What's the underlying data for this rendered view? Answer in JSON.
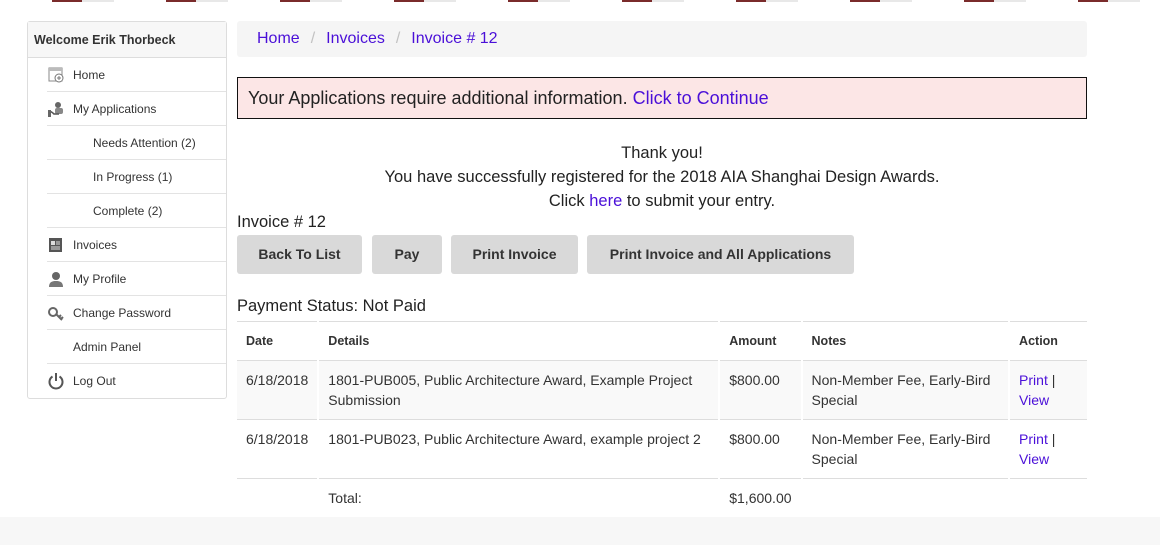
{
  "sidebar": {
    "welcome": "Welcome Erik Thorbeck",
    "items": [
      {
        "label": "Home",
        "icon": "home-icon"
      },
      {
        "label": "My Applications",
        "icon": "applications-icon"
      },
      {
        "label": "Needs Attention (2)"
      },
      {
        "label": "In Progress (1)"
      },
      {
        "label": "Complete (2)"
      },
      {
        "label": "Invoices",
        "icon": "invoice-icon"
      },
      {
        "label": "My Profile",
        "icon": "profile-icon"
      },
      {
        "label": "Change Password",
        "icon": "key-icon"
      },
      {
        "label": "Admin Panel"
      },
      {
        "label": "Log Out",
        "icon": "power-icon"
      }
    ]
  },
  "breadcrumb": [
    "Home",
    "Invoices",
    "Invoice # 12"
  ],
  "alert": {
    "text": "Your Applications require additional information.",
    "link": "Click to Continue"
  },
  "thanks": {
    "line1": "Thank you!",
    "line2": "You have successfully registered for the 2018 AIA Shanghai Design Awards.",
    "line3_pre": "Click",
    "line3_link": "here",
    "line3_post": "to submit your entry."
  },
  "invoice_title": "Invoice # 12",
  "buttons": {
    "back": "Back To List",
    "pay": "Pay",
    "print": "Print Invoice",
    "print_all": "Print Invoice and All Applications"
  },
  "payment_status": "Payment Status: Not Paid",
  "table": {
    "headers": [
      "Date",
      "Details",
      "Amount",
      "Notes",
      "Action"
    ],
    "rows": [
      {
        "date": "6/18/2018",
        "details": "1801-PUB005, Public Architecture Award, Example Project Submission",
        "amount": "$800.00",
        "notes": "Non-Member Fee, Early-Bird Special",
        "print": "Print",
        "sep": "|",
        "view": "View"
      },
      {
        "date": "6/18/2018",
        "details": "1801-PUB023, Public Architecture Award, example project 2",
        "amount": "$800.00",
        "notes": "Non-Member Fee, Early-Bird Special",
        "print": "Print",
        "sep": "|",
        "view": "View"
      }
    ],
    "total_label": "Total:",
    "total_amount": "$1,600.00"
  },
  "colors": {
    "link": "#4a0fd8",
    "alert_bg": "#fce6e6",
    "button_bg": "#d9d9d9",
    "breadcrumb_bg": "#f5f5f5"
  }
}
